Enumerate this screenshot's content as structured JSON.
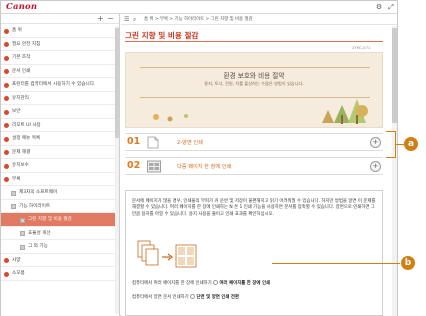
{
  "header": {
    "logo": "Canon",
    "icons": [
      "gear-icon",
      "expand-icon"
    ]
  },
  "sidebar": {
    "tools": [
      "+",
      "−"
    ],
    "items": [
      {
        "label": "홈 위",
        "level": 0
      },
      {
        "label": "필요 안전 지침",
        "level": 0
      },
      {
        "label": "기본 조작",
        "level": 0
      },
      {
        "label": "문서 인쇄",
        "level": 0
      },
      {
        "label": "프린터를 컴퓨터에서 사용하기 수 있습니다.",
        "level": 0
      },
      {
        "label": "유지관리",
        "level": 0
      },
      {
        "label": "보안",
        "level": 0
      },
      {
        "label": "리모트 UI 사용",
        "level": 0
      },
      {
        "label": "설정 메뉴 목록",
        "level": 0
      },
      {
        "label": "문제 해결",
        "level": 0
      },
      {
        "label": "유지보수",
        "level": 0
      },
      {
        "label": "부록",
        "level": 0
      },
      {
        "label": "제3자의 소프트웨어",
        "level": 1
      },
      {
        "label": "기능 하이라이트",
        "level": 1
      },
      {
        "label": "그린 지향 및 비용 절감",
        "level": 2,
        "selected": true
      },
      {
        "label": "효율성 개선",
        "level": 2
      },
      {
        "label": "그 외 기능",
        "level": 2
      },
      {
        "label": "사양",
        "level": 0
      },
      {
        "label": "소모품",
        "level": 0
      }
    ]
  },
  "breadcrumb": {
    "text": "홈 위 > 부록 > 기능 하이라이트 > 그린 지향 및 비용 절감"
  },
  "page": {
    "title": "그린 지향 및 비용 절감",
    "doc_id": "2Y9C-071"
  },
  "banner": {
    "heading": "환경 보호와 비용 절약",
    "subtitle": "용지, 토너, 전원, 치를 플상하는 수많은 방법이 있습니다."
  },
  "steps": [
    {
      "number": "01",
      "label": "2-양면 인쇄",
      "icon": "duplex-page-icon"
    },
    {
      "number": "02",
      "label": "다중 페이지 한 장에 인쇄",
      "icon": "multipage-icon"
    }
  ],
  "detail": {
    "paragraph": "문서에 페이지가 많을 경우, 인쇄물의 부피가 커 운반 및 저장이 불편해지고 읽기 어려워질 수 있습니다. 하지만 방법을 알면 이 문제를 해결할 수 있습니다. 여러 페이지를 한 장에 인쇄하는 N 온 1 인쇄 기능을 사용하면 문서를 압축할 수 있습니다. 양면으로 인쇄하면 그만큼 용지를 아낄 수 있습니다. 용지 사용을 줄이고 인쇄 효과를 확인하십시오.",
    "line1_prefix": "컴퓨터에서 여러 페이지를 한 장에 인쇄하기",
    "line1_link": "여러 페이지를 한 장에 인쇄",
    "line2_prefix": "컴퓨터에서 양면 문서 인쇄하기",
    "line2_link": "단면 및 양면 인쇄 전환"
  },
  "callouts": {
    "a": "a",
    "b": "b"
  },
  "colors": {
    "brand": "#c8102e",
    "accent": "#e07a23",
    "callout": "#d17f12",
    "selected": "#e07a63"
  }
}
